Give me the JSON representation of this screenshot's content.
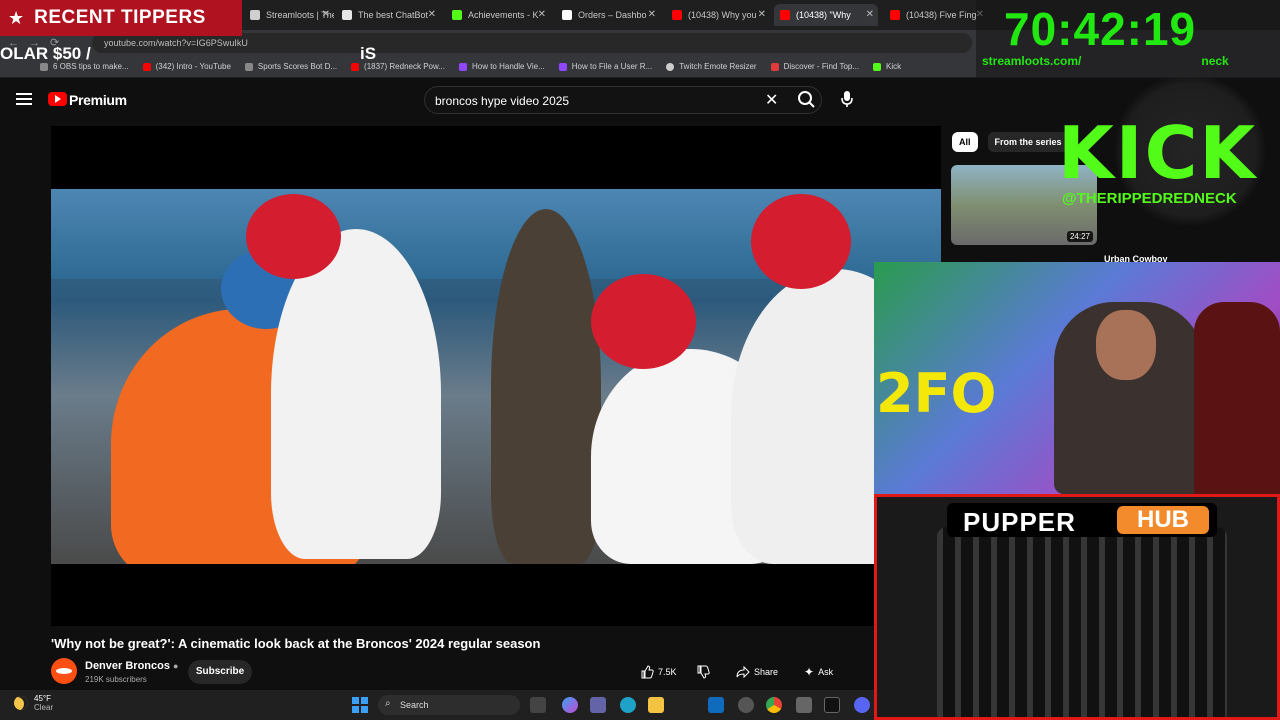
{
  "overlay": {
    "tippers_title": "RECENT TIPPERS",
    "ticker_left": "OLAR $50 /",
    "ticker_right": "iS",
    "timer": "70:42:19",
    "timer_url": "streamloots.com/",
    "timer_url_tail": "neck",
    "kick_logo": "KICK",
    "kick_handle": "@THERIPPEDREDNECK",
    "cam_decal": "2FO",
    "pupper_word1": "PUPPER",
    "pupper_word2": "HUB"
  },
  "browser": {
    "tabs": [
      {
        "label": "Streamloots | The",
        "color": "#e6e6e6"
      },
      {
        "label": "The best ChatBot",
        "color": "#e6e6e6"
      },
      {
        "label": "Achievements - K",
        "color": "#53fc18"
      },
      {
        "label": "Orders – Dashbo",
        "color": "#ffffff"
      },
      {
        "label": "(10438) Why you",
        "color": "#ff0000"
      },
      {
        "label": "(10438) \"Why",
        "color": "#ff0000"
      },
      {
        "label": "(10438) Five Fing",
        "color": "#ff0000"
      }
    ],
    "url": "youtube.com/watch?v=IG6PSwuIkU",
    "bookmarks": [
      {
        "label": "6 OBS tips to make...",
        "color": "#888888"
      },
      {
        "label": "(342) Intro - YouTube",
        "color": "#ff0000"
      },
      {
        "label": "Sports Scores Bot D...",
        "color": "#888888"
      },
      {
        "label": "(1837) Redneck Pow...",
        "color": "#ff0000"
      },
      {
        "label": "How to Handle Vie...",
        "color": "#9146ff"
      },
      {
        "label": "How to File a User R...",
        "color": "#9146ff"
      },
      {
        "label": "Twitch Emote Resizer",
        "color": "#cccccc"
      },
      {
        "label": "Discover - Find Top...",
        "color": "#e23b3b"
      },
      {
        "label": "Kick",
        "color": "#53fc18"
      }
    ]
  },
  "youtube": {
    "brand": "Premium",
    "search_query": "broncos hype video 2025",
    "video_title": "'Why not be great?': A cinematic look back at the Broncos' 2024 regular season",
    "channel_name": "Denver Broncos",
    "subscribers": "219K subscribers",
    "subscribe_label": "Subscribe",
    "likes": "7.5K",
    "share_label": "Share",
    "ask_label": "Ask",
    "chips": [
      "All",
      "From the series"
    ],
    "related": [
      {
        "duration": "24:27",
        "title": "Urban Cowboy"
      }
    ]
  },
  "taskbar": {
    "temperature": "45°F",
    "condition": "Clear",
    "search_label": "Search"
  }
}
